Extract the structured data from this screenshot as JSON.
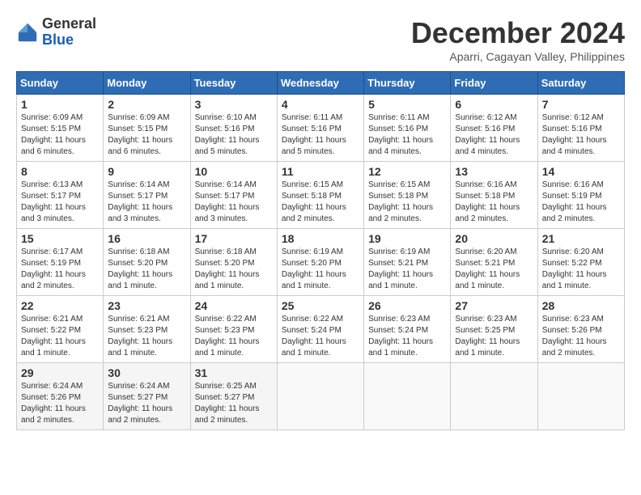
{
  "header": {
    "logo_general": "General",
    "logo_blue": "Blue",
    "month_title": "December 2024",
    "location": "Aparri, Cagayan Valley, Philippines"
  },
  "weekdays": [
    "Sunday",
    "Monday",
    "Tuesday",
    "Wednesday",
    "Thursday",
    "Friday",
    "Saturday"
  ],
  "weeks": [
    [
      {
        "day": "1",
        "sunrise": "6:09 AM",
        "sunset": "5:15 PM",
        "daylight": "11 hours and 6 minutes."
      },
      {
        "day": "2",
        "sunrise": "6:09 AM",
        "sunset": "5:15 PM",
        "daylight": "11 hours and 6 minutes."
      },
      {
        "day": "3",
        "sunrise": "6:10 AM",
        "sunset": "5:16 PM",
        "daylight": "11 hours and 5 minutes."
      },
      {
        "day": "4",
        "sunrise": "6:11 AM",
        "sunset": "5:16 PM",
        "daylight": "11 hours and 5 minutes."
      },
      {
        "day": "5",
        "sunrise": "6:11 AM",
        "sunset": "5:16 PM",
        "daylight": "11 hours and 4 minutes."
      },
      {
        "day": "6",
        "sunrise": "6:12 AM",
        "sunset": "5:16 PM",
        "daylight": "11 hours and 4 minutes."
      },
      {
        "day": "7",
        "sunrise": "6:12 AM",
        "sunset": "5:16 PM",
        "daylight": "11 hours and 4 minutes."
      }
    ],
    [
      {
        "day": "8",
        "sunrise": "6:13 AM",
        "sunset": "5:17 PM",
        "daylight": "11 hours and 3 minutes."
      },
      {
        "day": "9",
        "sunrise": "6:14 AM",
        "sunset": "5:17 PM",
        "daylight": "11 hours and 3 minutes."
      },
      {
        "day": "10",
        "sunrise": "6:14 AM",
        "sunset": "5:17 PM",
        "daylight": "11 hours and 3 minutes."
      },
      {
        "day": "11",
        "sunrise": "6:15 AM",
        "sunset": "5:18 PM",
        "daylight": "11 hours and 2 minutes."
      },
      {
        "day": "12",
        "sunrise": "6:15 AM",
        "sunset": "5:18 PM",
        "daylight": "11 hours and 2 minutes."
      },
      {
        "day": "13",
        "sunrise": "6:16 AM",
        "sunset": "5:18 PM",
        "daylight": "11 hours and 2 minutes."
      },
      {
        "day": "14",
        "sunrise": "6:16 AM",
        "sunset": "5:19 PM",
        "daylight": "11 hours and 2 minutes."
      }
    ],
    [
      {
        "day": "15",
        "sunrise": "6:17 AM",
        "sunset": "5:19 PM",
        "daylight": "11 hours and 2 minutes."
      },
      {
        "day": "16",
        "sunrise": "6:18 AM",
        "sunset": "5:20 PM",
        "daylight": "11 hours and 1 minute."
      },
      {
        "day": "17",
        "sunrise": "6:18 AM",
        "sunset": "5:20 PM",
        "daylight": "11 hours and 1 minute."
      },
      {
        "day": "18",
        "sunrise": "6:19 AM",
        "sunset": "5:20 PM",
        "daylight": "11 hours and 1 minute."
      },
      {
        "day": "19",
        "sunrise": "6:19 AM",
        "sunset": "5:21 PM",
        "daylight": "11 hours and 1 minute."
      },
      {
        "day": "20",
        "sunrise": "6:20 AM",
        "sunset": "5:21 PM",
        "daylight": "11 hours and 1 minute."
      },
      {
        "day": "21",
        "sunrise": "6:20 AM",
        "sunset": "5:22 PM",
        "daylight": "11 hours and 1 minute."
      }
    ],
    [
      {
        "day": "22",
        "sunrise": "6:21 AM",
        "sunset": "5:22 PM",
        "daylight": "11 hours and 1 minute."
      },
      {
        "day": "23",
        "sunrise": "6:21 AM",
        "sunset": "5:23 PM",
        "daylight": "11 hours and 1 minute."
      },
      {
        "day": "24",
        "sunrise": "6:22 AM",
        "sunset": "5:23 PM",
        "daylight": "11 hours and 1 minute."
      },
      {
        "day": "25",
        "sunrise": "6:22 AM",
        "sunset": "5:24 PM",
        "daylight": "11 hours and 1 minute."
      },
      {
        "day": "26",
        "sunrise": "6:23 AM",
        "sunset": "5:24 PM",
        "daylight": "11 hours and 1 minute."
      },
      {
        "day": "27",
        "sunrise": "6:23 AM",
        "sunset": "5:25 PM",
        "daylight": "11 hours and 1 minute."
      },
      {
        "day": "28",
        "sunrise": "6:23 AM",
        "sunset": "5:26 PM",
        "daylight": "11 hours and 2 minutes."
      }
    ],
    [
      {
        "day": "29",
        "sunrise": "6:24 AM",
        "sunset": "5:26 PM",
        "daylight": "11 hours and 2 minutes."
      },
      {
        "day": "30",
        "sunrise": "6:24 AM",
        "sunset": "5:27 PM",
        "daylight": "11 hours and 2 minutes."
      },
      {
        "day": "31",
        "sunrise": "6:25 AM",
        "sunset": "5:27 PM",
        "daylight": "11 hours and 2 minutes."
      },
      null,
      null,
      null,
      null
    ]
  ],
  "labels": {
    "sunrise": "Sunrise:",
    "sunset": "Sunset:",
    "daylight": "Daylight hours"
  }
}
